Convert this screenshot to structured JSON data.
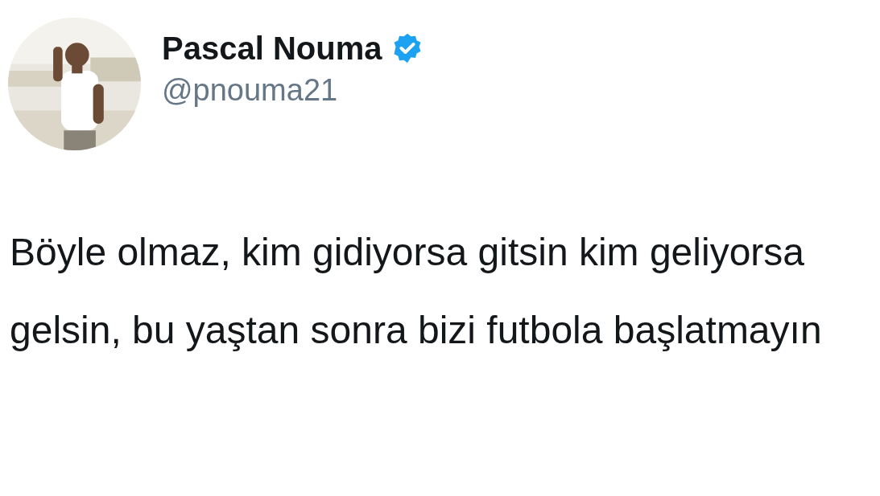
{
  "author": {
    "name": "Pascal Nouma",
    "verified": true,
    "handle": "@pnouma21"
  },
  "tweet": {
    "text": "Böyle olmaz, kim gidiyorsa gitsin kim geliyorsa gelsin, bu yaştan sonra bizi futbola başlatmayın"
  }
}
